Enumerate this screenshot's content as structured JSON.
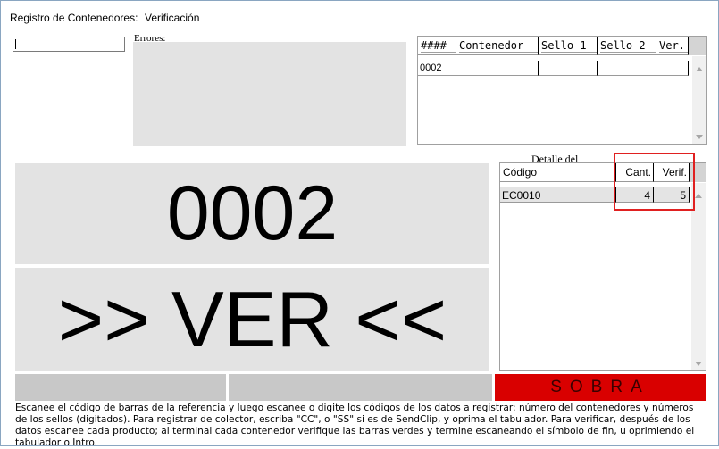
{
  "header": {
    "title": "Registro de Contenedores:",
    "mode": "Verificación"
  },
  "scan_input": {
    "value": ""
  },
  "errors": {
    "label": "Errores:",
    "text": ""
  },
  "containers_table": {
    "columns": [
      "####",
      "Contenedor",
      "Sello 1",
      "Sello 2",
      "Ver."
    ],
    "rows": [
      {
        "num": "0002",
        "contenedor": "",
        "sello1": "",
        "sello2": "",
        "ver": ""
      }
    ]
  },
  "current_container": "0002",
  "action_text": ">> VER <<",
  "detail": {
    "label": "Detalle del",
    "columns": [
      "Código",
      "Cant.",
      "Verif."
    ],
    "rows": [
      {
        "codigo": "EC0010",
        "cant": "4",
        "verif": "5"
      }
    ]
  },
  "status": {
    "text": "SOBRA",
    "color": "#d90000"
  },
  "help_text": "Escanee el código de barras de la referencia y luego escanee o digite los códigos de los datos a registrar: número del contenedores y números de los sellos (digitados). Para registrar de colector, escriba \"CC\", o \"SS\" si es de SendClip, y oprima el tabulador. Para verificar, después de los datos escanee cada producto; al terminal cada contenedor verifique las barras verdes y termine escaneando el símbolo de fin, u oprimiendo el tabulador o Intro."
}
